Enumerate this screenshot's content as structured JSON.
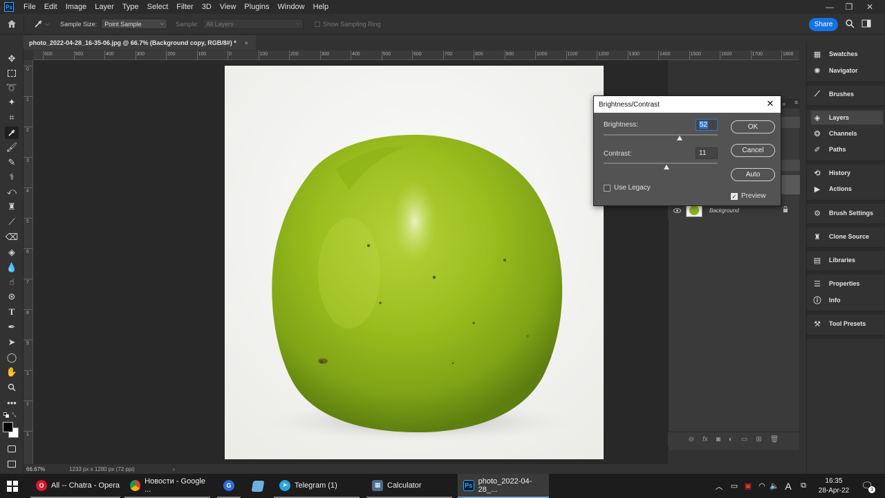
{
  "menubar": {
    "items": [
      "File",
      "Edit",
      "Image",
      "Layer",
      "Type",
      "Select",
      "Filter",
      "3D",
      "View",
      "Plugins",
      "Window",
      "Help"
    ],
    "controls": {
      "minimize": "—",
      "restore": "❐",
      "close": "✕"
    }
  },
  "options": {
    "sample_size_label": "Sample Size:",
    "sample_size_value": "Point Sample",
    "sample_label": "Sample:",
    "sample_value": "All Layers",
    "show_ring_label": "Show Sampling Ring",
    "share_label": "Share"
  },
  "document": {
    "tab_title": "photo_2022-04-28_16-35-06.jpg @ 66.7% (Background copy, RGB/8#) *",
    "close": "×"
  },
  "ruler": {
    "top_ticks": [
      "600",
      "500",
      "400",
      "300",
      "200",
      "100",
      "0",
      "100",
      "200",
      "300",
      "400",
      "500",
      "600",
      "700",
      "800",
      "900",
      "1000",
      "1100",
      "1200",
      "1300",
      "1400",
      "1500",
      "1600",
      "1700",
      "1800"
    ],
    "left_ticks": [
      "0",
      "1",
      "2",
      "3",
      "4",
      "5",
      "6",
      "7",
      "8",
      "9",
      "1",
      "1",
      "1"
    ]
  },
  "statusbar": {
    "zoom": "66.67%",
    "doc_info": "1233 px x 1280 px (72 ppi)",
    "arrow": "›"
  },
  "dialog": {
    "title": "Brightness/Contrast",
    "brightness_label": "Brightness:",
    "brightness_value": "52",
    "contrast_label": "Contrast:",
    "contrast_value": "11",
    "use_legacy_label": "Use Legacy",
    "use_legacy_checked": false,
    "ok_label": "OK",
    "cancel_label": "Cancel",
    "auto_label": "Auto",
    "preview_label": "Preview",
    "preview_checked": true
  },
  "layers": {
    "layer_name": "Background"
  },
  "dock": {
    "items": [
      {
        "label": "Swatches",
        "icon": "swatches-icon"
      },
      {
        "label": "Navigator",
        "icon": "navigator-icon"
      },
      {
        "label": "Brushes",
        "icon": "brushes-icon"
      },
      {
        "label": "Layers",
        "icon": "layers-icon"
      },
      {
        "label": "Channels",
        "icon": "channels-icon"
      },
      {
        "label": "Paths",
        "icon": "paths-icon"
      },
      {
        "label": "History",
        "icon": "history-icon"
      },
      {
        "label": "Actions",
        "icon": "actions-icon"
      },
      {
        "label": "Brush Settings",
        "icon": "brush-settings-icon"
      },
      {
        "label": "Clone Source",
        "icon": "clone-source-icon"
      },
      {
        "label": "Libraries",
        "icon": "libraries-icon"
      },
      {
        "label": "Properties",
        "icon": "properties-icon"
      },
      {
        "label": "Info",
        "icon": "info-icon"
      },
      {
        "label": "Tool Presets",
        "icon": "tool-presets-icon"
      }
    ]
  },
  "taskbar": {
    "apps": [
      {
        "label": "All -- Chatra - Opera",
        "icon": "opera-icon",
        "color": "#e0162b"
      },
      {
        "label": "Новости - Google ...",
        "icon": "chrome-icon",
        "color": "#e8a000"
      },
      {
        "label": "",
        "icon": "app-icon",
        "color": "#2a6fd6"
      },
      {
        "label": "",
        "icon": "app-icon-2",
        "color": "#6fb0e0"
      },
      {
        "label": "Telegram (1)",
        "icon": "telegram-icon",
        "color": "#2aa3e0"
      },
      {
        "label": "Calculator",
        "icon": "calculator-icon",
        "color": "#4a6c8c"
      },
      {
        "label": "photo_2022-04-28_...",
        "icon": "photoshop-icon",
        "color": "#001e36"
      }
    ],
    "time": "16:35",
    "date": "28-Apr-22",
    "notification_count": "3"
  },
  "colors": {
    "accent": "#1473e6",
    "apple_green": "#9bbf1e",
    "canvas_bg": "#282828"
  }
}
